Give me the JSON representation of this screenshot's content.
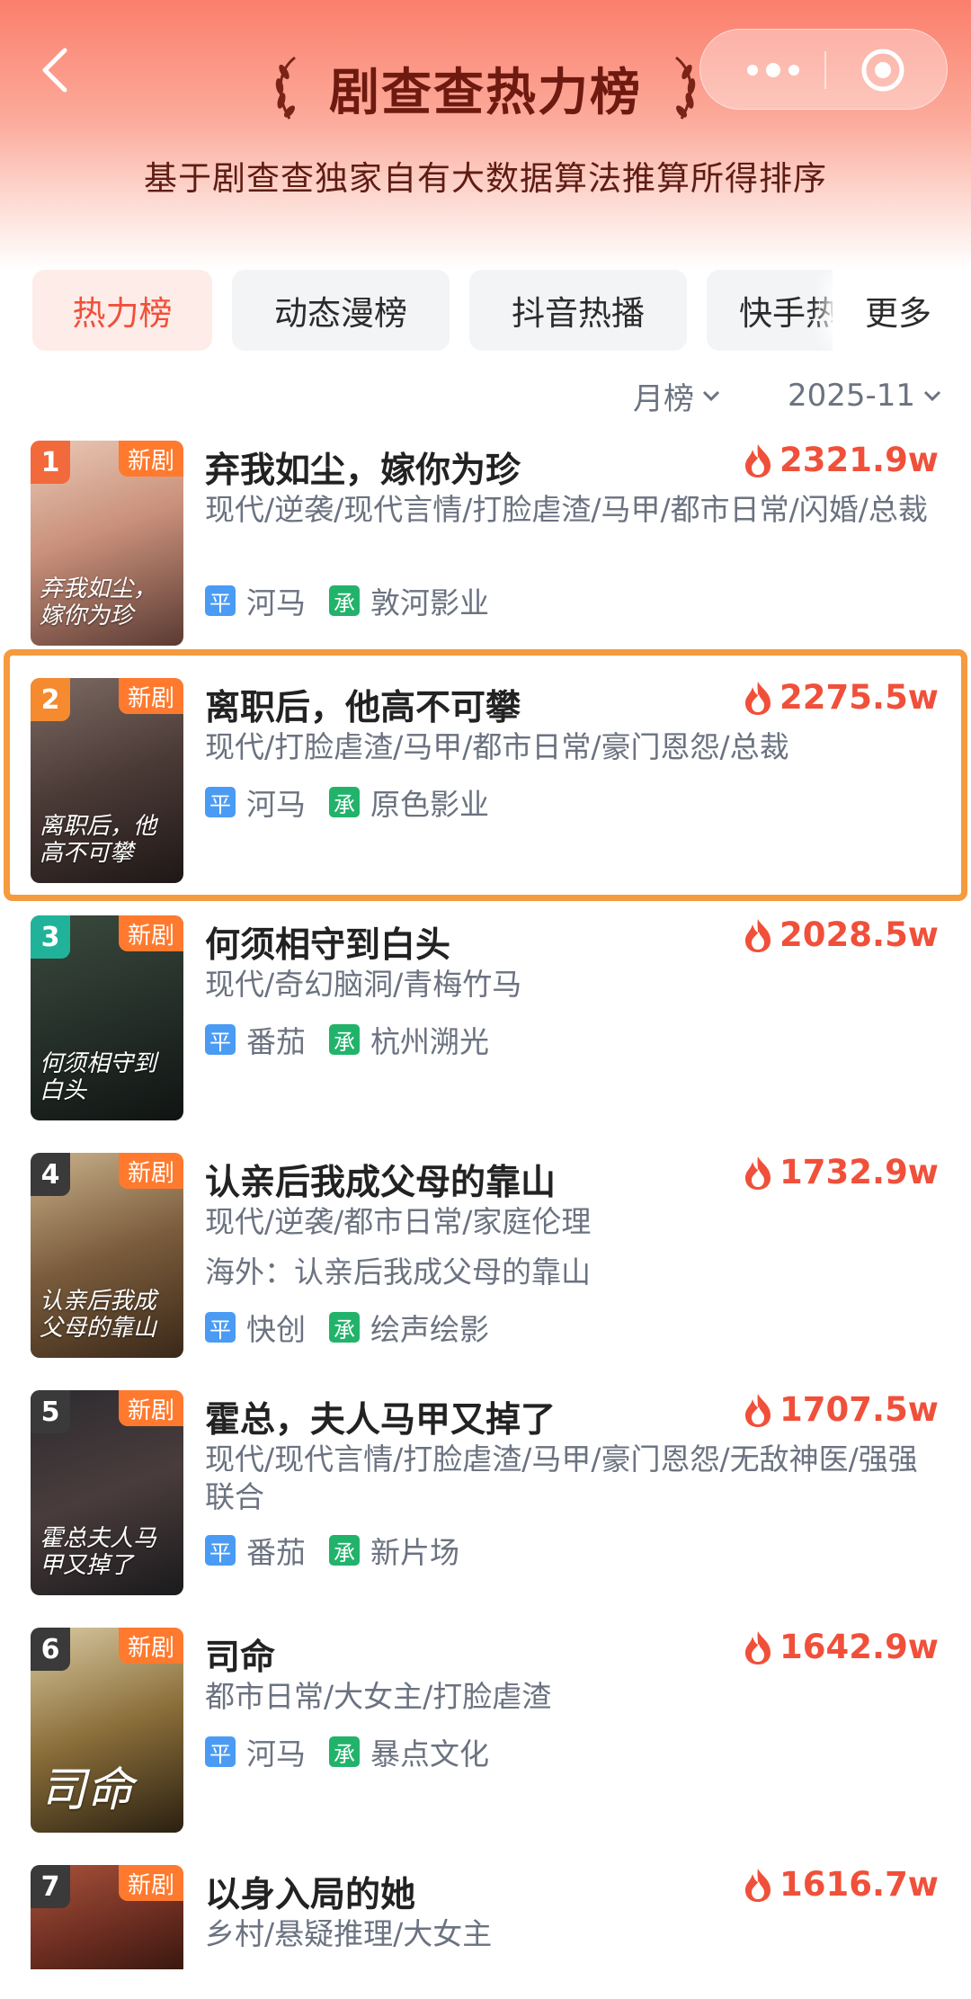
{
  "header": {
    "title": "剧查查热力榜",
    "subtitle": "基于剧查查独家自有大数据算法推算所得排序",
    "back_icon": "chevron-left-icon",
    "menu_icon": "more-dots-icon",
    "close_icon": "target-circle-icon"
  },
  "tabs": [
    {
      "label": "热力榜",
      "active": true
    },
    {
      "label": "动态漫榜",
      "active": false
    },
    {
      "label": "抖音热播",
      "active": false
    },
    {
      "label": "快手热",
      "active": false
    }
  ],
  "more_label": "更多",
  "filters": {
    "period": "月榜",
    "month": "2025-11"
  },
  "colors": {
    "accent": "#f0503a",
    "new_tag": "#ff7a2e",
    "highlight": "#f59a3d",
    "platform_badge": "#4a9bf4",
    "producer_badge": "#22b36b"
  },
  "items": [
    {
      "rank": "1",
      "new_tag": "新剧",
      "title": "弃我如尘，嫁你为珍",
      "heat": "2321.9w",
      "tags": "现代/逆袭/现代言情/打脸虐渣/马甲/都市日常/闪婚/总裁",
      "platform_badge": "平",
      "platform": "河马",
      "producer_badge": "承",
      "producer": "敦河影业",
      "poster_caption": "弃我如尘，嫁你为珍",
      "rank_color": "#f26a3b"
    },
    {
      "rank": "2",
      "new_tag": "新剧",
      "title": "离职后，他高不可攀",
      "heat": "2275.5w",
      "tags": "现代/打脸虐渣/马甲/都市日常/豪门恩怨/总裁",
      "platform_badge": "平",
      "platform": "河马",
      "producer_badge": "承",
      "producer": "原色影业",
      "poster_caption": "离职后，他高不可攀",
      "rank_color": "#f58a2e"
    },
    {
      "rank": "3",
      "new_tag": "新剧",
      "title": "何须相守到白头",
      "heat": "2028.5w",
      "tags": "现代/奇幻脑洞/青梅竹马",
      "platform_badge": "平",
      "platform": "番茄",
      "producer_badge": "承",
      "producer": "杭州溯光",
      "poster_caption": "何须相守到白头",
      "rank_color": "#20b39a"
    },
    {
      "rank": "4",
      "new_tag": "新剧",
      "title": "认亲后我成父母的靠山",
      "heat": "1732.9w",
      "tags": "现代/逆袭/都市日常/家庭伦理",
      "overseas": "海外：认亲后我成父母的靠山",
      "platform_badge": "平",
      "platform": "快创",
      "producer_badge": "承",
      "producer": "绘声绘影",
      "poster_caption": "认亲后我成父母的靠山",
      "rank_color": "#3a3a3a"
    },
    {
      "rank": "5",
      "new_tag": "新剧",
      "title": "霍总，夫人马甲又掉了",
      "heat": "1707.5w",
      "tags": "现代/现代言情/打脸虐渣/马甲/豪门恩怨/无敌神医/强强联合",
      "platform_badge": "平",
      "platform": "番茄",
      "producer_badge": "承",
      "producer": "新片场",
      "poster_caption": "霍总夫人马甲又掉了",
      "rank_color": "#3a3a3a"
    },
    {
      "rank": "6",
      "new_tag": "新剧",
      "title": "司命",
      "heat": "1642.9w",
      "tags": "都市日常/大女主/打脸虐渣",
      "platform_badge": "平",
      "platform": "河马",
      "producer_badge": "承",
      "producer": "暴点文化",
      "poster_caption": "司命",
      "rank_color": "#3a3a3a"
    },
    {
      "rank": "7",
      "new_tag": "新剧",
      "title": "以身入局的她",
      "heat": "1616.7w",
      "tags": "乡村/悬疑推理/大女主",
      "rank_color": "#3a3a3a"
    }
  ]
}
